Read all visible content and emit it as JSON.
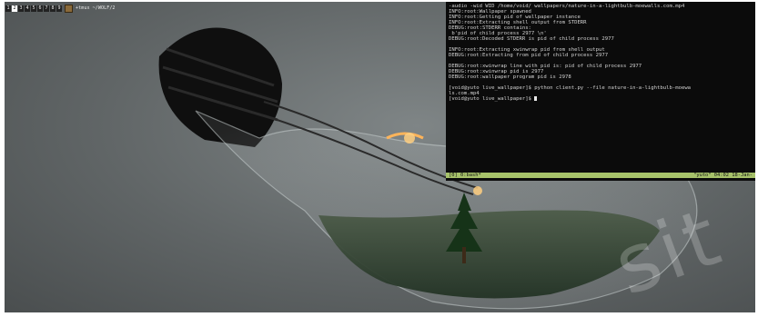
{
  "topbar": {
    "workspaces": [
      "1",
      "2",
      "3",
      "4",
      "5",
      "6",
      "7",
      "8",
      "9"
    ],
    "active": "2",
    "window_title": "+tmux ~/WOLF/2"
  },
  "terminal": {
    "lines": [
      "-audio -wid WID /home/void/ wallpapers/nature-in-a-lightbulb-moewalls.com.mp4",
      "INFO:root:Wallpaper spawned",
      "INFO:root:Getting pid of wallpaper instance",
      "INFO:root:Extracting shell output from STDERR",
      "DEBUG:root:STDERR contains:",
      " b'pid of child process 2977 \\n'",
      "DEBUG:root:Decoded STDERR is pid of child process 2977",
      "",
      "INFO:root:Extracting xwinwrap pid from shell output",
      "DEBUG:root:Extracting from pid of child process 2977",
      "",
      "DEBUG:root:xwinwrap line with pid is: pid of child process 2977",
      "DEBUG:root:xwinwrap pid is 2977",
      "DEBUG:root:wallpaper program pid is 2978",
      "",
      "[void@yuto live_wallpaper]$ python client.py --file nature-in-a-lightbulb-moewa",
      "ls.com.mp4",
      "[void@yuto live_wallpaper]$ "
    ],
    "status_left": "[0] 0:bash*",
    "status_right": "\"yuto\" 04:02 18-Jan-"
  },
  "watermark": "sit",
  "colors": {
    "status_bar": "#a7c26a",
    "terminal_bg": "#0b0b0b",
    "terminal_fg": "#d2d2d2"
  }
}
